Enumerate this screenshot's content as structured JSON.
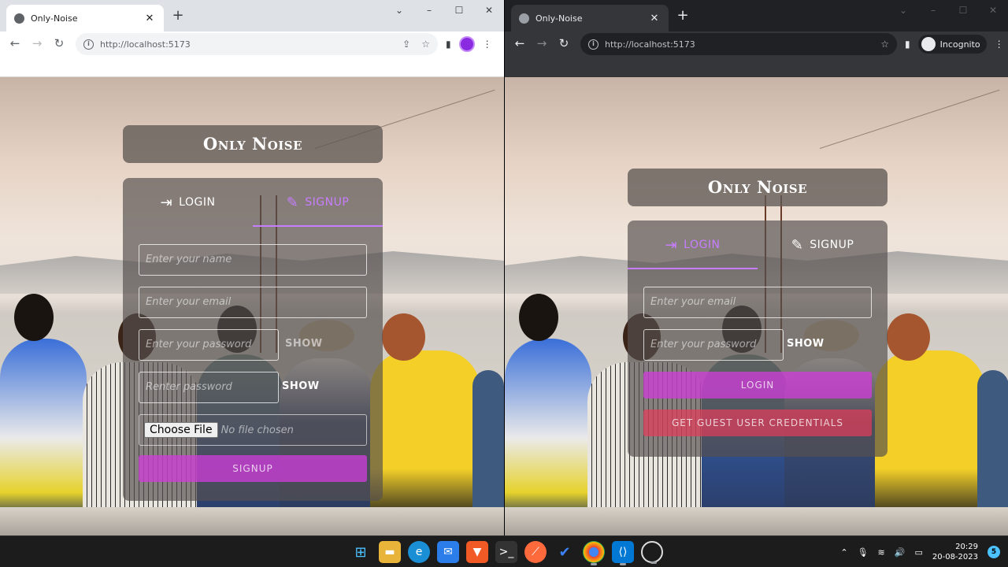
{
  "left_window": {
    "tab_title": "Only-Noise",
    "url": "http://localhost:5173",
    "app_title": "Only Noise",
    "tabs": {
      "login": "LOGIN",
      "signup": "SIGNUP"
    },
    "active_tab": "signup",
    "form": {
      "name_placeholder": "Enter your name",
      "email_placeholder": "Enter your email",
      "password_placeholder": "Enter your password",
      "repassword_placeholder": "Renter password",
      "show_label": "SHOW",
      "show_label_2": "SHOW",
      "choose_file": "Choose File",
      "no_file": "No file chosen",
      "submit": "SIGNUP"
    }
  },
  "right_window": {
    "tab_title": "Only-Noise",
    "url": "http://localhost:5173",
    "incognito_label": "Incognito",
    "app_title": "Only Noise",
    "tabs": {
      "login": "LOGIN",
      "signup": "SIGNUP"
    },
    "active_tab": "login",
    "form": {
      "email_placeholder": "Enter your email",
      "password_placeholder": "Enter your password",
      "show_label": "SHOW",
      "submit": "LOGIN",
      "guest": "GET GUEST USER CREDENTIALS"
    }
  },
  "taskbar": {
    "time": "20:29",
    "date": "20-08-2023",
    "notification_count": "5"
  },
  "colors": {
    "accent_purple": "#c77dff",
    "button_pink": "#d23cdc",
    "button_red": "#e63c5a"
  }
}
